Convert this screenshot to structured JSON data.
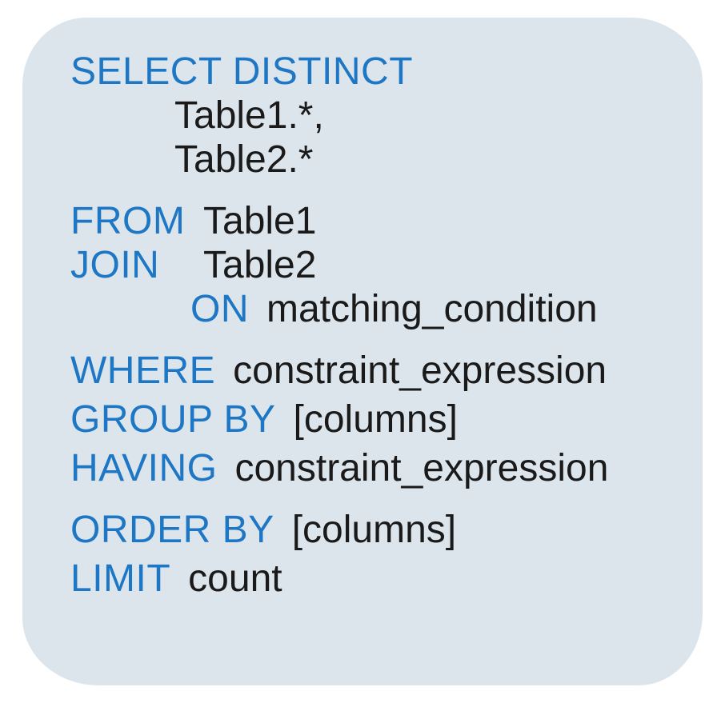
{
  "sql": {
    "select_distinct": "SELECT DISTINCT",
    "select_cols": [
      "Table1.*,",
      "Table2.*"
    ],
    "from_kw": "FROM",
    "from_val": "Table1",
    "join_kw": "JOIN",
    "join_val": "Table2",
    "on_kw": "ON",
    "on_val": "matching_condition",
    "where_kw": "WHERE",
    "where_val": "constraint_expression",
    "groupby_kw": "GROUP BY",
    "groupby_val": "[columns]",
    "having_kw": "HAVING",
    "having_val": "constraint_expression",
    "orderby_kw": "ORDER BY",
    "orderby_val": "[columns]",
    "limit_kw": "LIMIT",
    "limit_val": "count"
  }
}
